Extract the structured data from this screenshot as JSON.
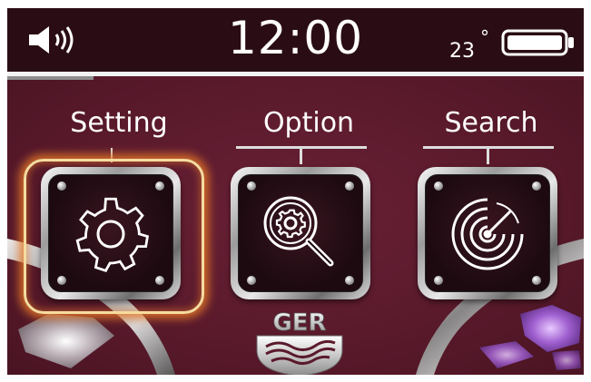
{
  "status_bar": {
    "time": "12:00",
    "temperature": "23",
    "temperature_unit": "°",
    "speaker_icon": "speaker-volume-icon",
    "battery_icon": "battery-icon",
    "battery_level": 1.0
  },
  "menu": {
    "items": [
      {
        "label": "Setting",
        "icon": "gear-icon",
        "selected": true
      },
      {
        "label": "Option",
        "icon": "magnify-gear-icon",
        "selected": false
      },
      {
        "label": "Search",
        "icon": "radar-icon",
        "selected": false
      }
    ]
  },
  "logo": {
    "text": "GER"
  },
  "colors": {
    "background": "#5a1a2c",
    "status_bar": "#2a0d14",
    "focus_ring": "#f5dca0",
    "focus_glow": "#e67828"
  }
}
